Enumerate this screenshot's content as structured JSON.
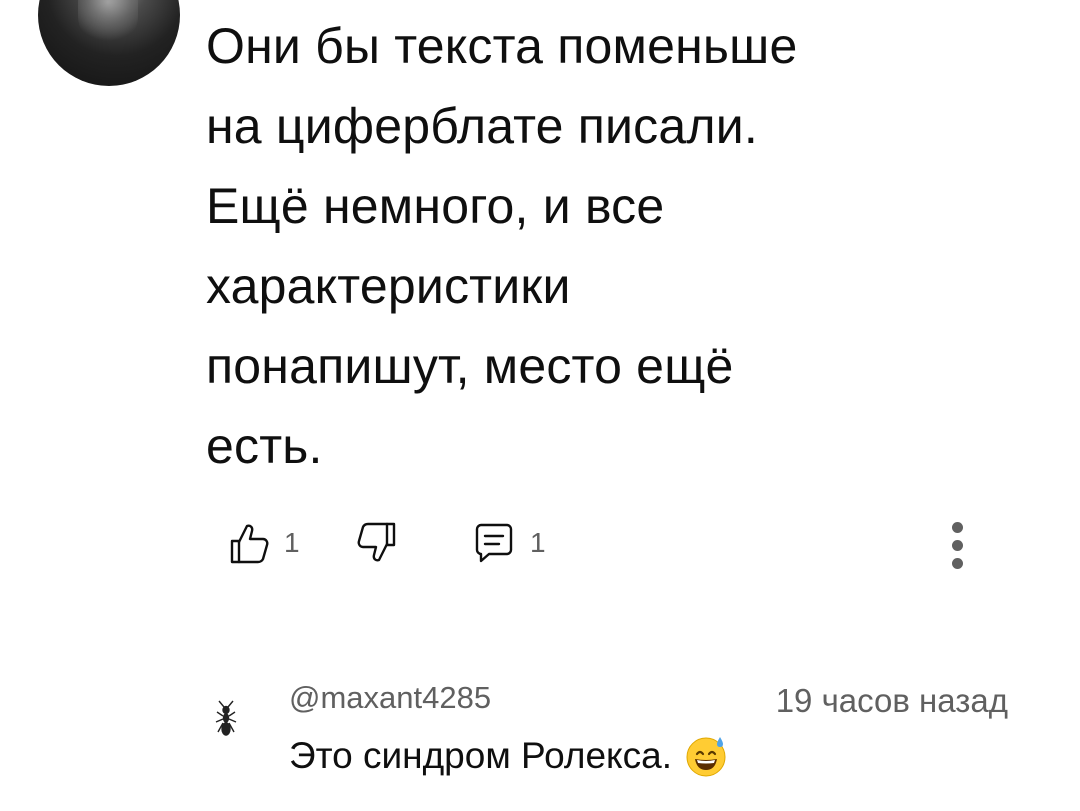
{
  "comment": {
    "text": "Они бы текста поменьше\nна циферблате писали.\nЕщё немного, и все\nхарактеристики\nпонапишут, место ещё\nесть.",
    "like_count": "1",
    "reply_count": "1",
    "icons": {
      "like": "thumb-up-icon",
      "dislike": "thumb-down-icon",
      "reply": "comment-icon",
      "more": "more-vert-icon"
    }
  },
  "reply": {
    "username": "@maxant4285",
    "time": "19 часов назад",
    "text": "Это синдром Ролекса.",
    "emoji": "grinning-sweat-emoji"
  }
}
